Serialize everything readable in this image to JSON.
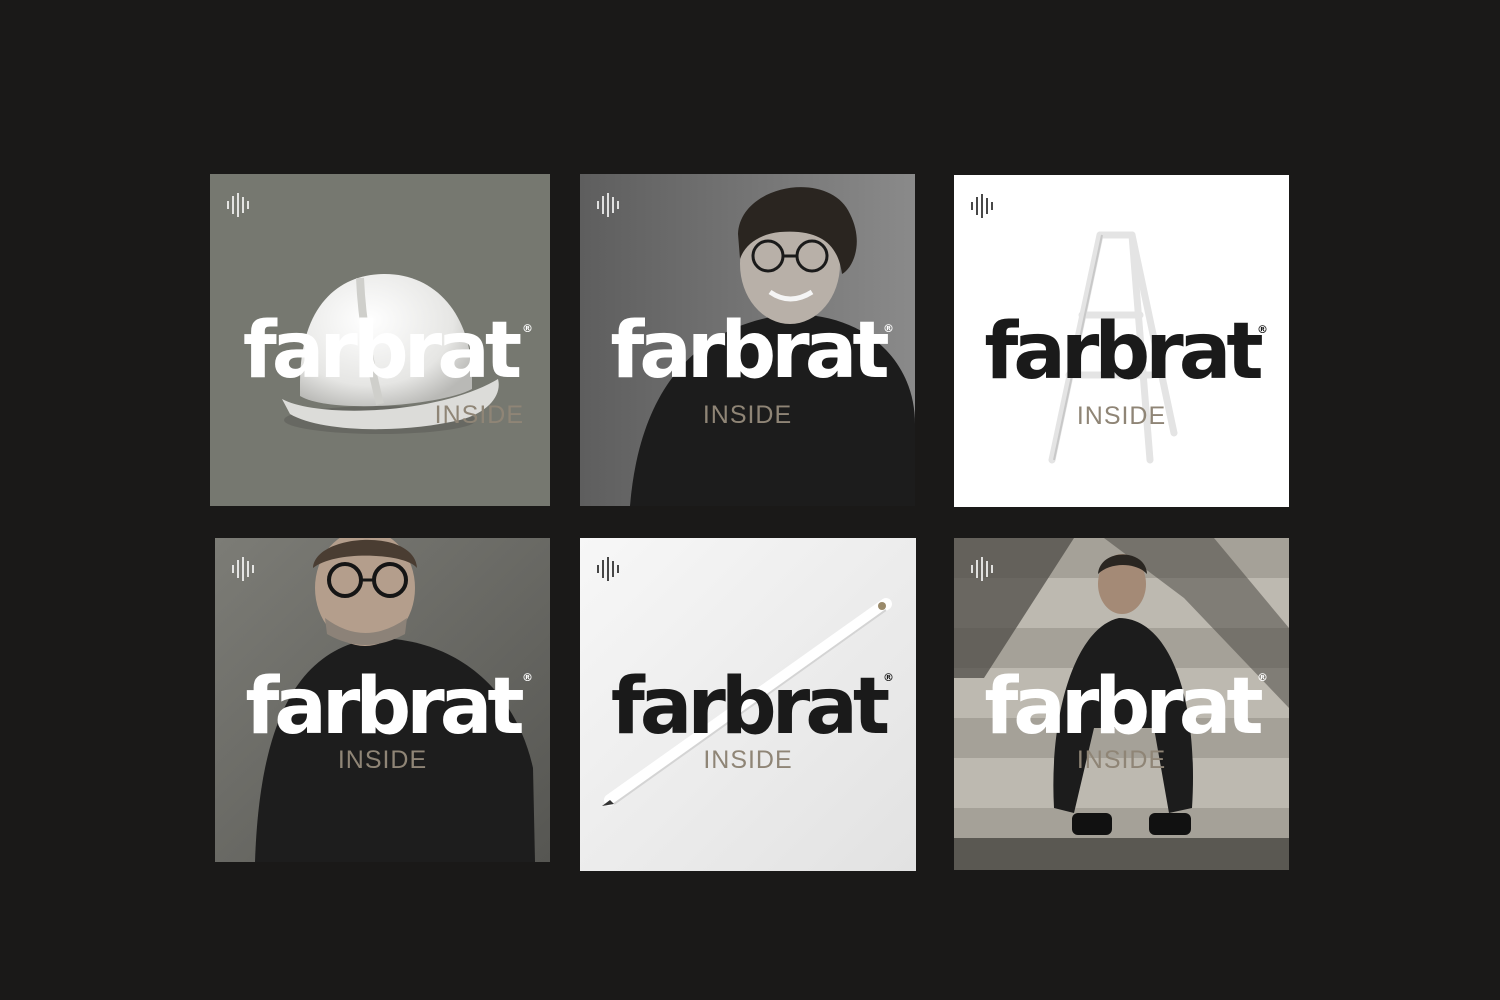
{
  "brand": {
    "wordmark": "farbrat",
    "registered": "®",
    "subtitle": "INSIDE",
    "subtitle_color": "#8f8576",
    "icon": "soundwave-icon"
  },
  "tiles": [
    {
      "background": "#777870",
      "logo_color": "#ffffff",
      "image": "white hard hat"
    },
    {
      "background": "#6d6d6d",
      "logo_color": "#ffffff",
      "image": "smiling man with glasses"
    },
    {
      "background": "#ffffff",
      "logo_color": "#1a1a1a",
      "image": "white step ladder"
    },
    {
      "background": "#6a6a66",
      "logo_color": "#ffffff",
      "image": "older man with glasses"
    },
    {
      "background": "#f2f2f2",
      "logo_color": "#1a1a1a",
      "image": "white pencil"
    },
    {
      "background": "#9a968e",
      "logo_color": "#ffffff",
      "image": "man sitting on concrete steps"
    }
  ]
}
